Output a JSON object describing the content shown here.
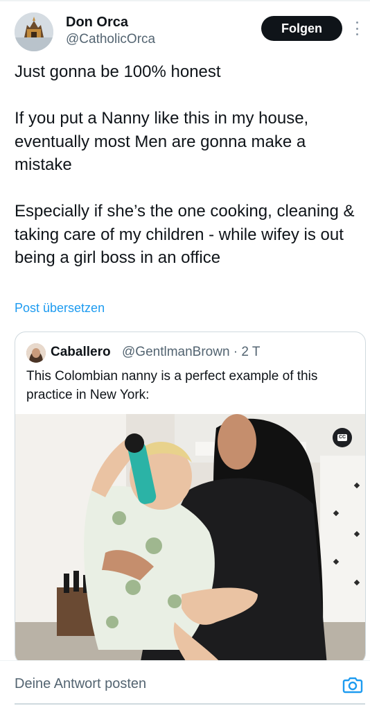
{
  "author": {
    "display_name": "Don Orca",
    "handle": "@CatholicOrca",
    "avatar_icon": "avatar-icon"
  },
  "header": {
    "follow_label": "Folgen",
    "more_icon": "more-vertical-icon"
  },
  "tweet": {
    "paragraphs": [
      "Just gonna be 100% honest",
      "If you put a Nanny like this in my house, eventually most Men are gonna make a mistake",
      "Especially if she’s the one cooking, cleaning & taking care of my children - while wifey is out being a girl boss in an office"
    ],
    "translate_label": "Post übersetzen"
  },
  "quoted": {
    "display_name": "Caballero",
    "handle_time": "@GentlmanBrown · 2 T",
    "text": "This Colombian nanny is a perfect example of this practice in New York:",
    "media_badge": "CC"
  },
  "reply": {
    "placeholder": "Deine Antwort posten",
    "camera_icon": "camera-icon"
  },
  "colors": {
    "accent": "#1d9bf0",
    "text_primary": "#0f1419",
    "text_secondary": "#536471",
    "follow_bg": "#0f1419"
  }
}
